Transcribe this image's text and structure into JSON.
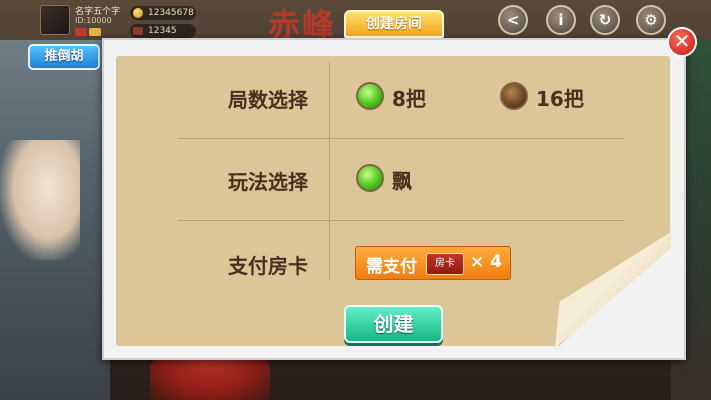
{
  "background": {
    "title_glyphs": "赤峰"
  },
  "player": {
    "name": "名字五个字",
    "id": "ID:10000",
    "coins": "12345678",
    "cards": "12345"
  },
  "top_icons": [
    {
      "name": "share-icon",
      "glyph": "<"
    },
    {
      "name": "info-icon",
      "glyph": "i"
    },
    {
      "name": "refresh-icon",
      "glyph": "↻"
    },
    {
      "name": "settings-icon",
      "glyph": "⚙"
    }
  ],
  "mode_tab": "推倒胡",
  "dialog": {
    "title": "创建房间",
    "close_glyph": "✕",
    "rounds": {
      "label": "局数选择",
      "options": [
        {
          "label": "8把",
          "selected": true
        },
        {
          "label": "16把",
          "selected": false
        }
      ]
    },
    "play": {
      "label": "玩法选择",
      "options": [
        {
          "label": "飘",
          "selected": true
        }
      ]
    },
    "payment": {
      "label": "支付房卡",
      "prefix": "需支付",
      "card": "房卡",
      "count": "× 4"
    },
    "create_button": "创建"
  },
  "colors": {
    "paper": "#dcc597",
    "accent_orange": "#f07d10",
    "create_green": "#1ab487",
    "mode_blue": "#1b7fd6"
  }
}
